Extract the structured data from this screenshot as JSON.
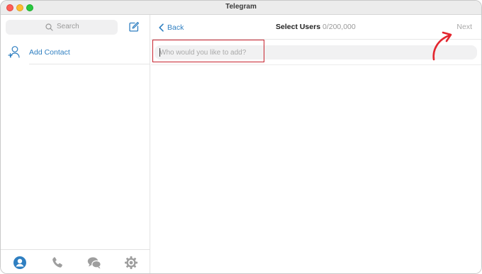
{
  "window": {
    "title": "Telegram"
  },
  "sidebar": {
    "search": {
      "placeholder": "Search"
    },
    "add_contact_label": "Add Contact",
    "bottom_tabs": [
      "contacts-icon",
      "calls-icon",
      "chats-icon",
      "settings-icon"
    ]
  },
  "main": {
    "back_label": "Back",
    "title": "Select Users",
    "count": "0/200,000",
    "next_label": "Next",
    "search": {
      "placeholder": "Who would you like to add?",
      "value": ""
    }
  },
  "colors": {
    "accent": "#2f7fc1",
    "annotation": "#e3262f",
    "highlight_border": "#c8242f"
  }
}
